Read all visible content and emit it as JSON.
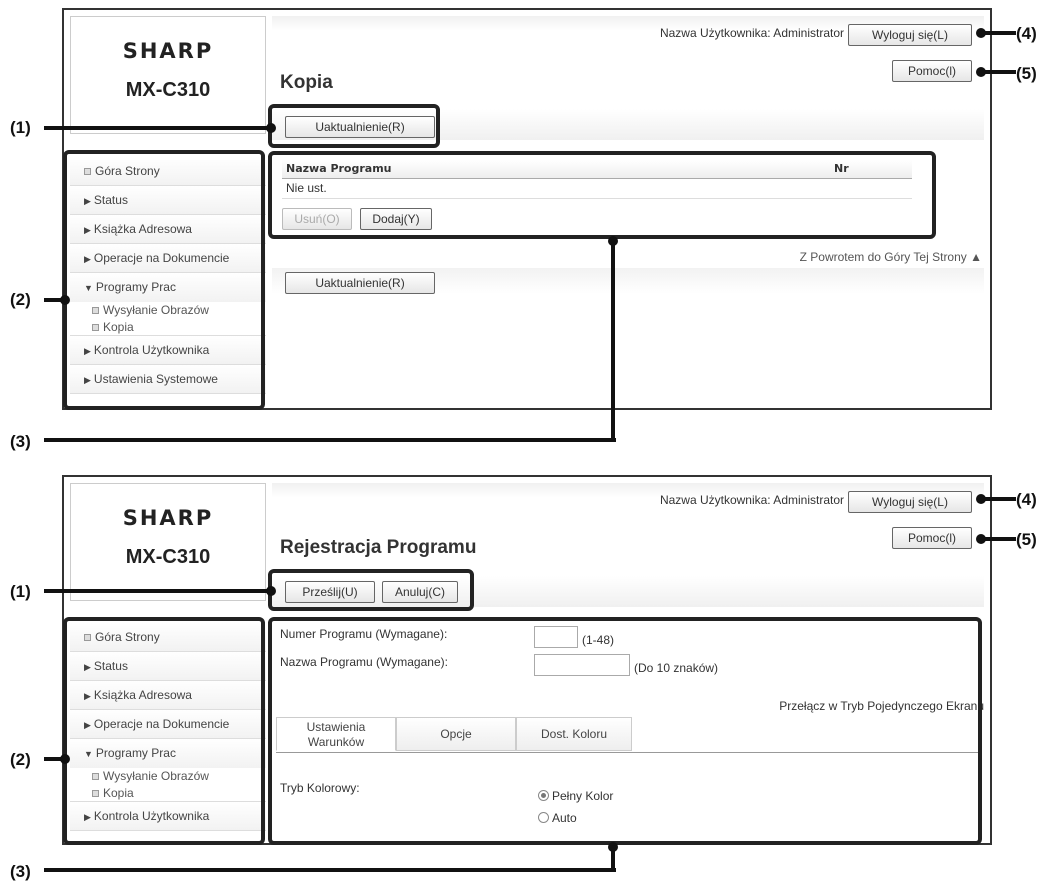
{
  "logo": {
    "brand": "SHARP",
    "model": "MX-C310"
  },
  "header": {
    "user_label": "Nazwa Użytkownika: Administrator",
    "logout": "Wyloguj się(L)",
    "help": "Pomoc(l)"
  },
  "sidebar": {
    "top": "Góra Strony",
    "status": "Status",
    "address_book": "Książka Adresowa",
    "doc_ops": "Operacje na Dokumencie",
    "job_programs": "Programy Prac",
    "image_send": "Wysyłanie Obrazów",
    "copy": "Kopia",
    "user_control": "Kontrola Użytkownika",
    "system_settings": "Ustawienia Systemowe"
  },
  "screen1": {
    "title": "Kopia",
    "update": "Uaktualnienie(R)",
    "table": {
      "headers": [
        "Nazwa Programu",
        "Nr"
      ],
      "rows": [
        [
          "Nie ust.",
          ""
        ]
      ]
    },
    "delete": "Usuń(O)",
    "add": "Dodaj(Y)",
    "back_to_top": "Z Powrotem do Góry Tej Strony ▲",
    "update2": "Uaktualnienie(R)"
  },
  "screen2": {
    "title": "Rejestracja Programu",
    "submit": "Prześlij(U)",
    "cancel": "Anuluj(C)",
    "program_number_label": "Numer Programu (Wymagane):",
    "program_number_value": "",
    "program_number_hint": "(1-48)",
    "program_name_label": "Nazwa Programu (Wymagane):",
    "program_name_value": "",
    "program_name_hint": "(Do 10 znaków)",
    "single_screen": "Przełącz w Tryb Pojedynczego Ekranu",
    "tabs": [
      "Ustawienia\nWarunków",
      "Opcje",
      "Dost. Koloru"
    ],
    "color_mode_label": "Tryb Kolorowy:",
    "color_full": "Pełny Kolor",
    "color_auto": "Auto",
    "color_selected": "Pełny Kolor"
  },
  "callouts": {
    "c1": "(1)",
    "c2": "(2)",
    "c3": "(3)",
    "c4": "(4)",
    "c5": "(5)"
  }
}
